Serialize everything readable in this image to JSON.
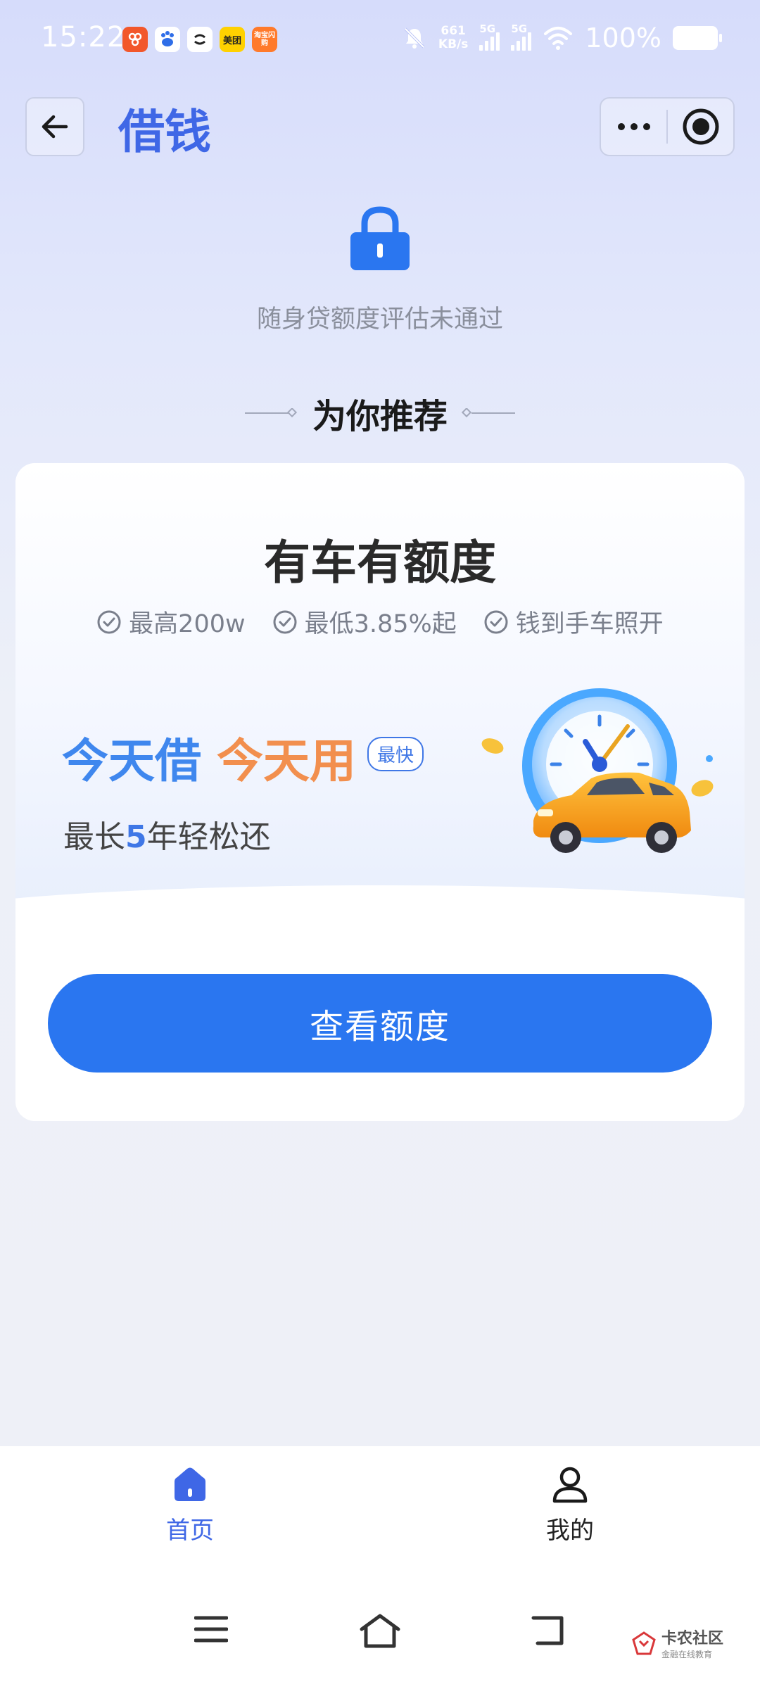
{
  "status_bar": {
    "time": "15:22",
    "apps": [
      {
        "name": "app-icon-1",
        "label": "",
        "color": "#f2572b"
      },
      {
        "name": "baidu-icon",
        "label": "",
        "color": "#ffffff"
      },
      {
        "name": "app-icon-3",
        "label": "",
        "color": "#ffffff"
      },
      {
        "name": "meituan-icon",
        "label": "美团",
        "color": "#ffd100"
      },
      {
        "name": "taobao-shangou-icon",
        "label": "淘宝闪购",
        "color": "#ff7a2b"
      }
    ],
    "net_speed_value": "661",
    "net_speed_unit": "KB/s",
    "signal_1_tag": "5G",
    "signal_2_tag": "5G",
    "battery_percent": "100%"
  },
  "header": {
    "back_icon": "back-arrow-icon",
    "title": "借钱",
    "more_icon": "more-dots-icon",
    "close_icon": "record-target-icon"
  },
  "notice": {
    "icon": "lock-icon",
    "text": "随身贷额度评估未通过"
  },
  "recommend": {
    "title": "为你推荐"
  },
  "card": {
    "title": "有车有额度",
    "features": [
      "最高200w",
      "最低3.85%起",
      "钱到手车照开"
    ],
    "feature_icon": "check-circle-icon",
    "slogan_blue": "今天借",
    "slogan_orange": "今天用",
    "badge": "最快",
    "sub_slogan_prefix": "最长",
    "sub_slogan_highlight": "5",
    "sub_slogan_suffix": "年轻松还",
    "illustration": "clock-car-illustration",
    "cta_label": "查看额度"
  },
  "tab_bar": {
    "tabs": [
      {
        "label": "首页",
        "icon": "home-icon",
        "active": true
      },
      {
        "label": "我的",
        "icon": "user-icon",
        "active": false
      }
    ]
  },
  "system_nav": {
    "menu_icon": "menu-icon",
    "home_icon": "home-outline-icon",
    "back_icon": "back-return-icon"
  },
  "watermark": {
    "main": "卡农社区",
    "sub": "金融在线教育"
  },
  "colors": {
    "primary": "#2a76f0",
    "title_blue": "#3f67e6",
    "slogan_blue": "#3f87ee",
    "slogan_orange": "#f28f4e"
  }
}
